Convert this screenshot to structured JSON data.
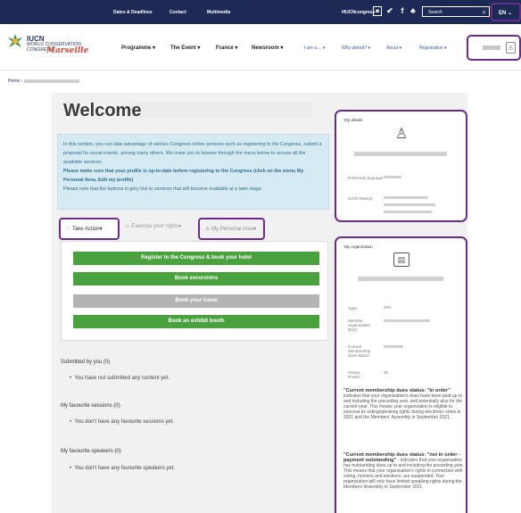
{
  "topbar": {
    "links": [
      "Dates & Deadlines",
      "Contact",
      "Multimedia"
    ],
    "hashtag": "#IUCNcongress",
    "search_placeholder": "Search",
    "lang": "EN"
  },
  "logo": {
    "line1": "IUCN",
    "line2": "WORLD CONSERVATION",
    "line3": "CONGRESS",
    "line4": "Marseille"
  },
  "nav": {
    "main": [
      "Programme",
      "The Event",
      "France",
      "Newsroom"
    ],
    "secondary": [
      "I am a ...",
      "Why attend?",
      "About",
      "Registration"
    ]
  },
  "breadcrumb": {
    "home": "Home"
  },
  "page": {
    "title": "Welcome"
  },
  "info": {
    "p1": "In this section, you can take advantage of various Congress online services such as registering to the Congress, submit a proposal for social events, among many others. We invite you to browse through the menu below to access all the available services.",
    "p2": "Please make sure that your profile is up-to-date before registering to the Congress (click on the menu My Personal Area, Edit my profile)",
    "p3": "Please note that the buttons in grey link to services that will become available at a later stage."
  },
  "tabs": {
    "take_action": "Take Action",
    "exercise_rights": "Exercise your rights",
    "personal_area": "My Personal Area"
  },
  "buttons": {
    "register": "Register to the Congress & book your hotel",
    "excursions": "Book excursions",
    "travel": "Book your travel",
    "exhibit": "Book an exhibit booth"
  },
  "submitted": {
    "title": "Submitted by you (0)",
    "empty": "You have not submitted any content yet."
  },
  "sessions": {
    "title": "My favourite sessions (0)",
    "empty": "You don't have any favourite sessions yet."
  },
  "speakers": {
    "title": "My favourite speakers (0)",
    "empty": "You don't have any favourite speakers yet."
  },
  "details": {
    "title": "My details",
    "preferred_language_label": "Preferred language:",
    "iucn_roles_label": "IUCN Role(s):"
  },
  "organization": {
    "title": "My organization",
    "type_label": "Type:",
    "member_id_label": "Member organization ID(s):",
    "dues_label": "Current Membership dues status:",
    "voting_label": "Voting Power:",
    "in_order_title": "\"Current membership dues status: \"In order\"",
    "in_order_text": "indicates that your organization's dues have been paid up to and including the preceding year, and potentially also for the current year. This means your organization is eligible to exercise its voting/speaking rights during electronic votes in 2021 and the Members' Assembly in September 2021.",
    "not_order_title": "\"Current membership dues status: \"not in order - payment outstanding\"",
    "not_order_text": "- indicates that your organisation has outstanding dues up to and including the preceding year. This means that your organisation's rights in connection with voting, motions and elections, are suspended. Your organization will only have limited speaking rights during the Members' Assembly in September 2021."
  }
}
